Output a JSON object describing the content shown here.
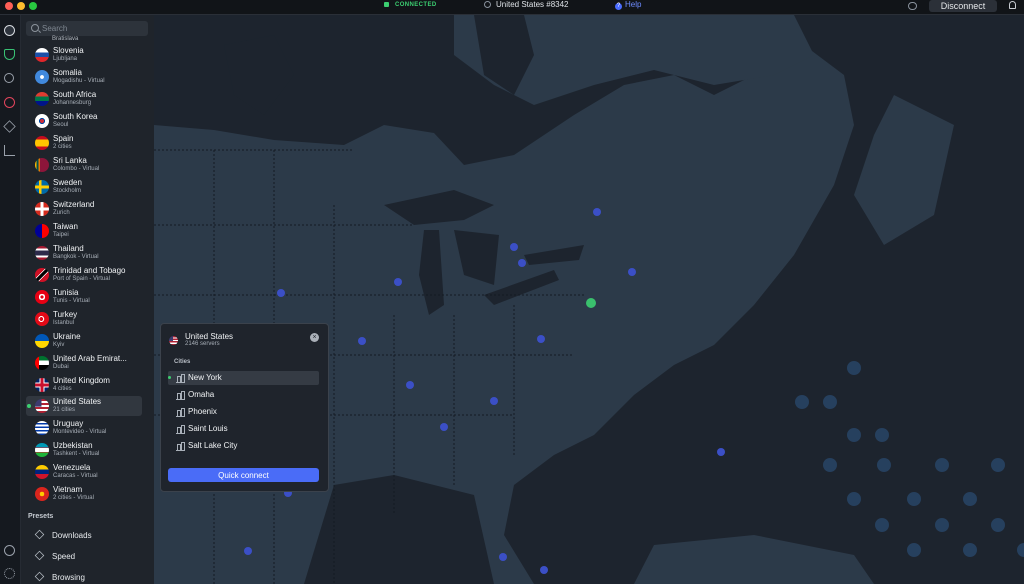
{
  "status": {
    "connection": "CONNECTED",
    "server": "United States #8342",
    "help": "Help",
    "disconnect": "Disconnect"
  },
  "search": {
    "placeholder": "Search"
  },
  "sidebar": {
    "partial_item": "Bratislava",
    "countries": [
      {
        "name": "Slovenia",
        "sub": "Ljubljana"
      },
      {
        "name": "Somalia",
        "sub": "Mogadishu - Virtual"
      },
      {
        "name": "South Africa",
        "sub": "Johannesburg"
      },
      {
        "name": "South Korea",
        "sub": "Seoul"
      },
      {
        "name": "Spain",
        "sub": "2 cities"
      },
      {
        "name": "Sri Lanka",
        "sub": "Colombo - Virtual"
      },
      {
        "name": "Sweden",
        "sub": "Stockholm"
      },
      {
        "name": "Switzerland",
        "sub": "Zurich"
      },
      {
        "name": "Taiwan",
        "sub": "Taipei"
      },
      {
        "name": "Thailand",
        "sub": "Bangkok - Virtual"
      },
      {
        "name": "Trinidad and Tobago",
        "sub": "Port of Spain - Virtual"
      },
      {
        "name": "Tunisia",
        "sub": "Tunis - Virtual"
      },
      {
        "name": "Turkey",
        "sub": "Istanbul"
      },
      {
        "name": "Ukraine",
        "sub": "Kyiv"
      },
      {
        "name": "United Arab Emirat...",
        "sub": "Dubai"
      },
      {
        "name": "United Kingdom",
        "sub": "4 cities"
      },
      {
        "name": "United States",
        "sub": "21 cities"
      },
      {
        "name": "Uruguay",
        "sub": "Montevideo - Virtual"
      },
      {
        "name": "Uzbekistan",
        "sub": "Tashkent - Virtual"
      },
      {
        "name": "Venezuela",
        "sub": "Caracas - Virtual"
      },
      {
        "name": "Vietnam",
        "sub": "2 cities - Virtual"
      }
    ],
    "presets_title": "Presets",
    "presets": [
      {
        "label": "Downloads"
      },
      {
        "label": "Speed"
      },
      {
        "label": "Browsing"
      }
    ]
  },
  "popup": {
    "title": "United States",
    "subtitle": "2146 servers",
    "close": "×",
    "cities_label": "Cities",
    "cities": [
      "New York",
      "Omaha",
      "Phoenix",
      "Saint Louis",
      "Salt Lake City"
    ],
    "quick_connect": "Quick connect"
  },
  "colors": {
    "accent": "#4a6cf7",
    "connected": "#3ccf71",
    "map_bg": "#1d242e",
    "land": "#2c3a49"
  }
}
